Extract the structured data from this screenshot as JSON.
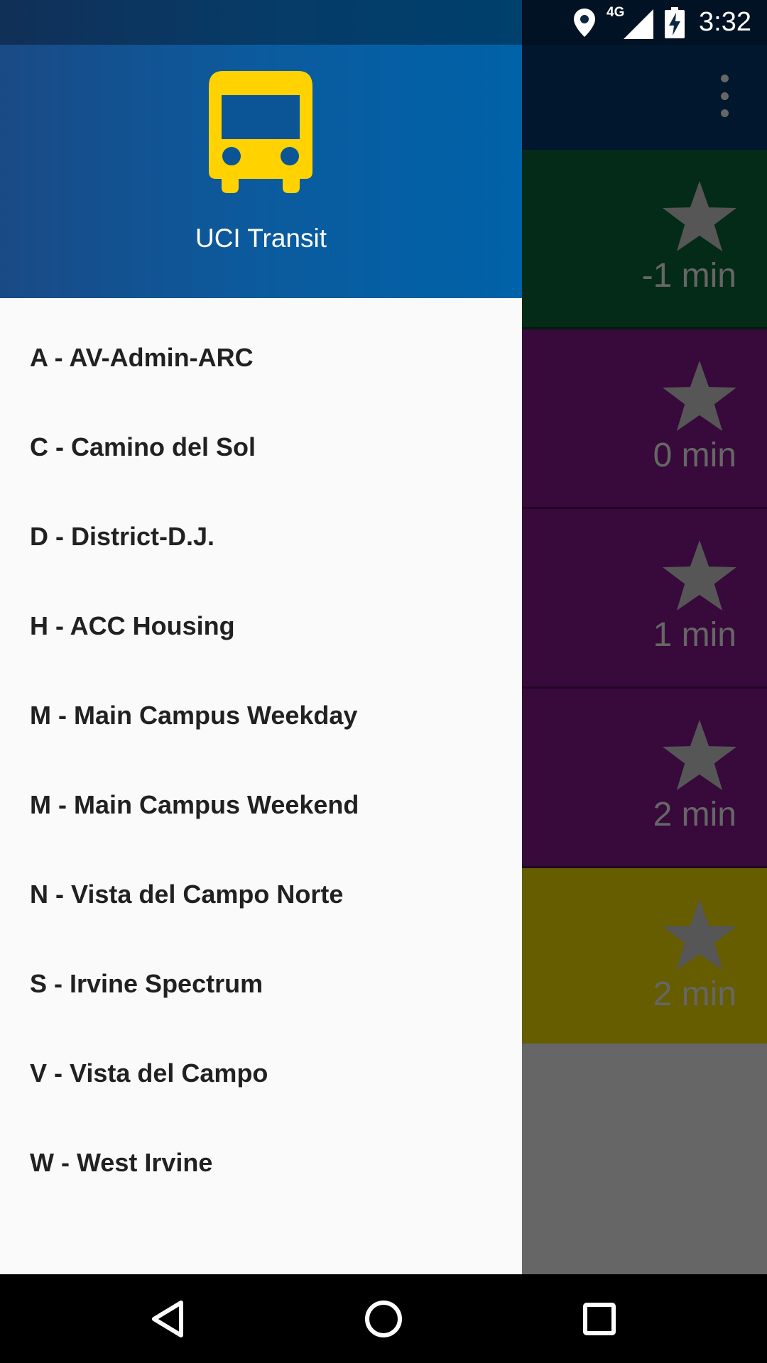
{
  "status_bar": {
    "time": "3:32",
    "network_label": "4G",
    "icons": [
      "location-icon",
      "cellular-signal-icon",
      "battery-charging-icon"
    ]
  },
  "app": {
    "toolbar_color": "#003b70",
    "cards": [
      {
        "minutes": "-1 min",
        "color": "#0b6b3a"
      },
      {
        "minutes": "0 min",
        "color": "#8a1a93"
      },
      {
        "minutes": "1 min",
        "color": "#8a1a93"
      },
      {
        "minutes": "2 min",
        "color": "#8a1a93"
      },
      {
        "minutes": "2 min",
        "color": "#ffe600"
      }
    ]
  },
  "drawer": {
    "title": "UCI Transit",
    "logo_icon": "bus-icon",
    "logo_color": "#ffd200",
    "routes": [
      "A - AV-Admin-ARC",
      "C - Camino del Sol",
      "D - District-D.J.",
      "H - ACC Housing",
      "M - Main Campus Weekday",
      "M - Main Campus Weekend",
      "N - Vista del Campo Norte",
      "S - Irvine Spectrum",
      "V - Vista del Campo",
      "W - West Irvine"
    ]
  },
  "nav_bar": {
    "buttons": [
      "back-icon",
      "home-icon",
      "recents-icon"
    ]
  }
}
